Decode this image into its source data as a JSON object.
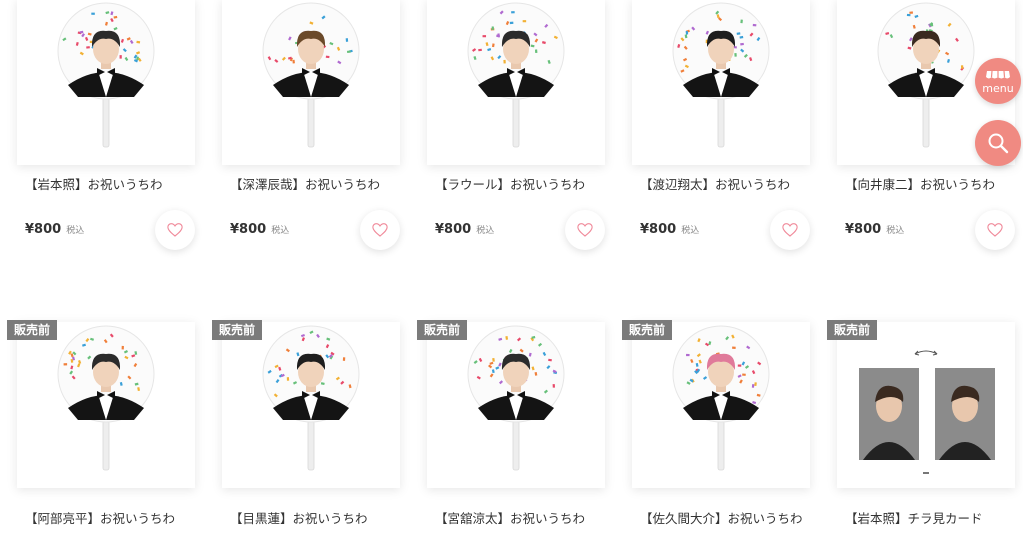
{
  "products": [
    {
      "name": "【岩本照】お祝いうちわ",
      "price": "¥800",
      "tax": "税込",
      "badge": "",
      "type": "fan",
      "bg": "#2b2b2b"
    },
    {
      "name": "【深澤辰哉】お祝いうちわ",
      "price": "¥800",
      "tax": "税込",
      "badge": "",
      "type": "fan",
      "bg": "#6b4a2a"
    },
    {
      "name": "【ラウール】お祝いうちわ",
      "price": "¥800",
      "tax": "税込",
      "badge": "",
      "type": "fan",
      "bg": "#2b2b2b"
    },
    {
      "name": "【渡辺翔太】お祝いうちわ",
      "price": "¥800",
      "tax": "税込",
      "badge": "",
      "type": "fan",
      "bg": "#1e1e1e"
    },
    {
      "name": "【向井康二】お祝いうちわ",
      "price": "¥800",
      "tax": "税込",
      "badge": "",
      "type": "fan",
      "bg": "#3a2a20"
    },
    {
      "name": "【阿部亮平】お祝いうちわ",
      "price": "",
      "tax": "",
      "badge": "販売前",
      "type": "fan",
      "bg": "#2b2b2b"
    },
    {
      "name": "【目黒蓮】お祝いうちわ",
      "price": "",
      "tax": "",
      "badge": "販売前",
      "type": "fan",
      "bg": "#1e1e1e"
    },
    {
      "name": "【宮舘涼太】お祝いうちわ",
      "price": "",
      "tax": "",
      "badge": "販売前",
      "type": "fan",
      "bg": "#2b2b2b"
    },
    {
      "name": "【佐久間大介】お祝いうちわ",
      "price": "",
      "tax": "",
      "badge": "販売前",
      "type": "fan",
      "bg": "#e07a9a"
    },
    {
      "name": "【岩本照】チラ見カード",
      "price": "",
      "tax": "",
      "badge": "販売前",
      "type": "card",
      "bg": "#3a2a20"
    }
  ],
  "fab": {
    "menu_label": "menu"
  },
  "icons": {
    "favorite": "heart-icon",
    "menu": "shop-awning-icon",
    "search": "search-icon"
  },
  "colors": {
    "accent": "#f08a82",
    "badge": "#7b7b7b"
  }
}
